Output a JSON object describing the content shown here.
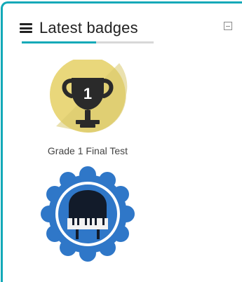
{
  "block": {
    "title": "Latest badges",
    "icons": {
      "menu": "hamburger-menu-icon",
      "collapse": "collapse-icon"
    },
    "colors": {
      "border": "#12a9b8",
      "accent": "#12a9b8",
      "trophyCircle": "#e9d77b",
      "pianoBadge": "#2f77c8"
    }
  },
  "badges": [
    {
      "name": "Grade 1 Final Test",
      "icon": "trophy-icon",
      "badgeNumber": "1"
    },
    {
      "name": "",
      "icon": "piano-icon"
    }
  ]
}
